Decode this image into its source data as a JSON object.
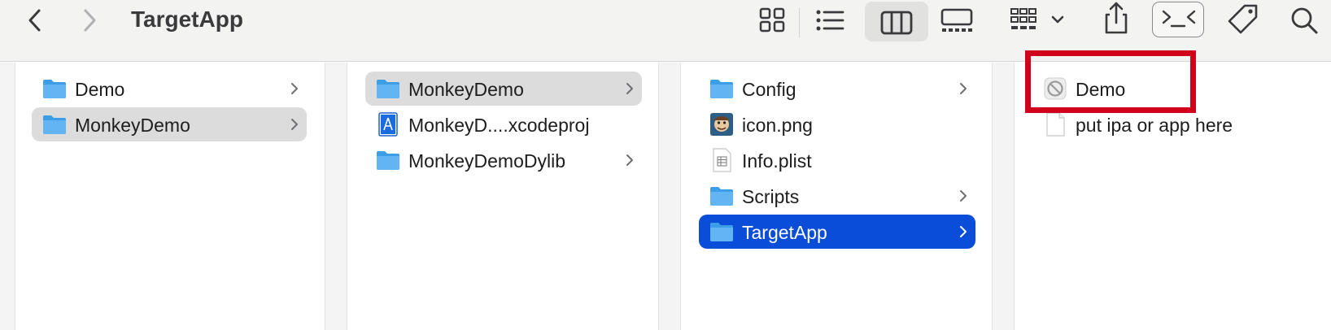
{
  "toolbar": {
    "title": "TargetApp",
    "back_icon": "chevron-left-icon",
    "forward_icon": "chevron-right-icon",
    "view_modes": [
      "icon-view-icon",
      "list-view-icon",
      "column-view-icon",
      "gallery-view-icon"
    ],
    "selected_view": "column-view-icon",
    "group_icon": "group-by-icon",
    "share_icon": "share-icon",
    "terminal_icon": "terminal-icon",
    "tag_icon": "tag-icon",
    "search_icon": "search-icon"
  },
  "columns": [
    {
      "items": [
        {
          "label": "Demo",
          "icon": "folder-icon",
          "has_children": true,
          "state": "none"
        },
        {
          "label": "MonkeyDemo",
          "icon": "folder-icon",
          "has_children": true,
          "state": "selected-inactive"
        }
      ]
    },
    {
      "items": [
        {
          "label": "MonkeyDemo",
          "icon": "folder-icon",
          "has_children": true,
          "state": "selected-inactive"
        },
        {
          "label": "MonkeyD....xcodeproj",
          "icon": "xcodeproj-icon",
          "has_children": false,
          "state": "none"
        },
        {
          "label": "MonkeyDemoDylib",
          "icon": "folder-icon",
          "has_children": true,
          "state": "none"
        }
      ]
    },
    {
      "items": [
        {
          "label": "Config",
          "icon": "folder-icon",
          "has_children": true,
          "state": "none"
        },
        {
          "label": "icon.png",
          "icon": "image-file-icon",
          "has_children": false,
          "state": "none"
        },
        {
          "label": "Info.plist",
          "icon": "plist-file-icon",
          "has_children": false,
          "state": "none"
        },
        {
          "label": "Scripts",
          "icon": "folder-icon",
          "has_children": true,
          "state": "none"
        },
        {
          "label": "TargetApp",
          "icon": "folder-icon",
          "has_children": true,
          "state": "selected-active"
        }
      ]
    },
    {
      "items": [
        {
          "label": "Demo",
          "icon": "prohibited-app-icon",
          "has_children": false,
          "state": "none",
          "annotated": true
        },
        {
          "label": "put ipa or app here",
          "icon": "blank-file-icon",
          "has_children": false,
          "state": "none"
        }
      ]
    }
  ],
  "colors": {
    "selection_active": "#0a4dd9",
    "selection_inactive": "#dcdcdc",
    "folder": "#3d9ee8",
    "annotation_box": "#d0021b"
  }
}
